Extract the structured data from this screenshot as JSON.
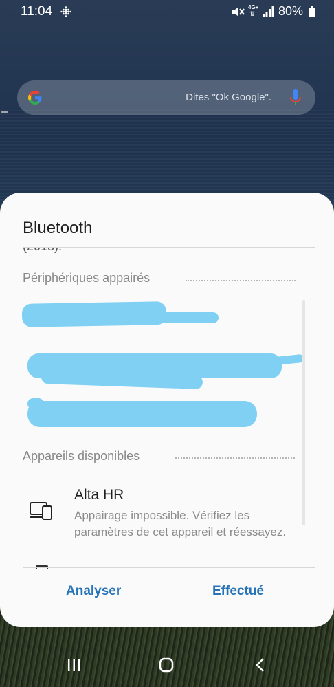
{
  "status_bar": {
    "time": "11:04",
    "network": "4G+",
    "battery": "80%"
  },
  "search": {
    "hint": "Dites \"Ok Google\"."
  },
  "dialog": {
    "title": "Bluetooth",
    "cut_text": "(2018).",
    "paired_label": "Périphériques appairés",
    "available_label": "Appareils disponibles",
    "device": {
      "name": "Alta HR",
      "status": "Appairage impossible. Vérifiez les paramètres de cet appareil et réessayez."
    },
    "buttons": {
      "scan": "Analyser",
      "done": "Effectué"
    }
  },
  "colors": {
    "accent": "#2673b8",
    "redaction": "#7fd0f3"
  }
}
